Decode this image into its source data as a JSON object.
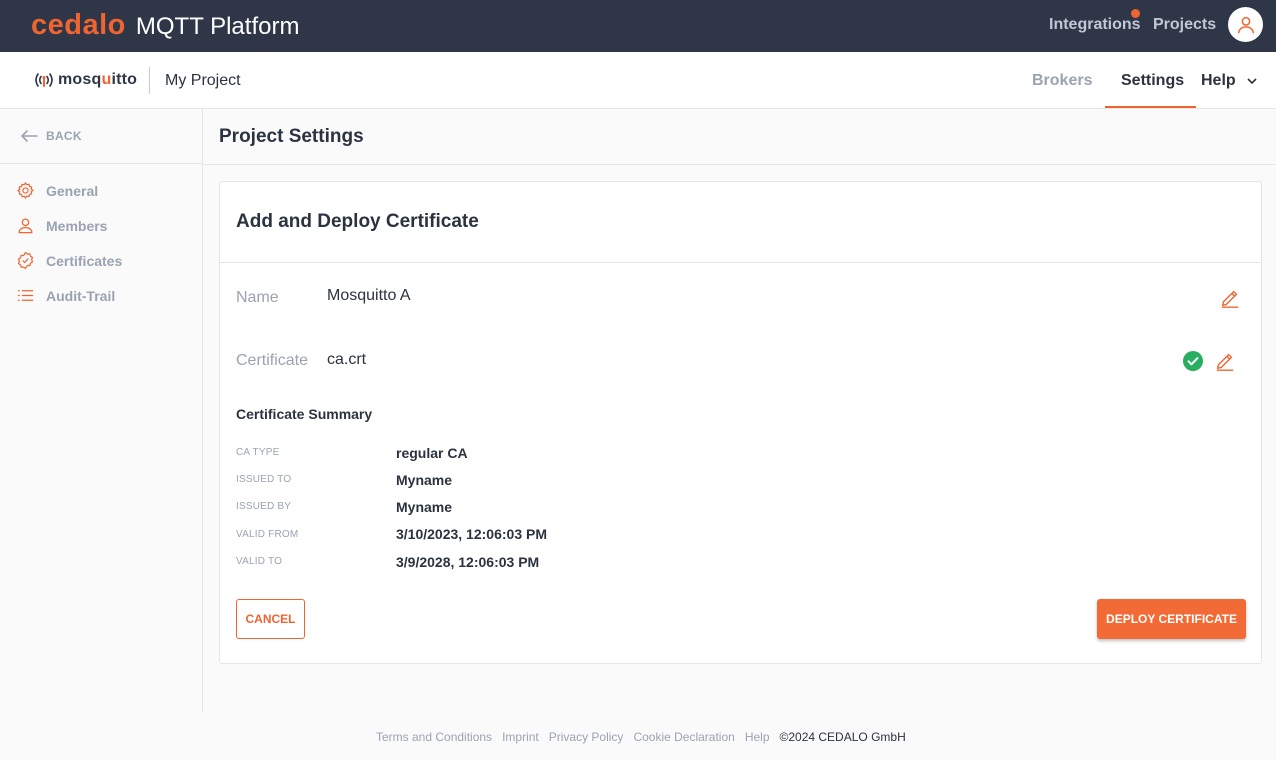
{
  "colors": {
    "accent": "#f06430",
    "topbar": "#2e3648",
    "muted": "#9aa3b2",
    "success": "#27ae60"
  },
  "topbar": {
    "logo": "cedalo",
    "title": "MQTT Platform",
    "integrations": "Integrations",
    "projects": "Projects"
  },
  "subbar": {
    "product_logo": "mosquitto",
    "project_name": "My Project",
    "tabs": {
      "brokers": "Brokers",
      "settings": "Settings",
      "help": "Help"
    },
    "active_tab": "Settings"
  },
  "sidebar": {
    "back": "BACK",
    "items": [
      {
        "label": "General",
        "icon": "gear-icon"
      },
      {
        "label": "Members",
        "icon": "person-icon"
      },
      {
        "label": "Certificates",
        "icon": "certificate-badge-icon"
      },
      {
        "label": "Audit-Trail",
        "icon": "list-icon"
      }
    ]
  },
  "page": {
    "title": "Project Settings"
  },
  "card": {
    "title": "Add and Deploy Certificate",
    "name_label": "Name",
    "name_value": "Mosquitto A",
    "cert_label": "Certificate",
    "cert_value": "ca.crt",
    "summary_title": "Certificate Summary",
    "summary": [
      {
        "key": "CA TYPE",
        "value": "regular CA"
      },
      {
        "key": "ISSUED TO",
        "value": "Myname"
      },
      {
        "key": "ISSUED BY",
        "value": "Myname"
      },
      {
        "key": "VALID FROM",
        "value": "3/10/2023, 12:06:03 PM"
      },
      {
        "key": "VALID TO",
        "value": "3/9/2028, 12:06:03 PM"
      }
    ],
    "cancel": "CANCEL",
    "deploy": "DEPLOY CERTIFICATE"
  },
  "footer": {
    "links": [
      "Terms and Conditions",
      "Imprint",
      "Privacy Policy",
      "Cookie Declaration",
      "Help"
    ],
    "copyright": "©2024 CEDALO GmbH"
  }
}
